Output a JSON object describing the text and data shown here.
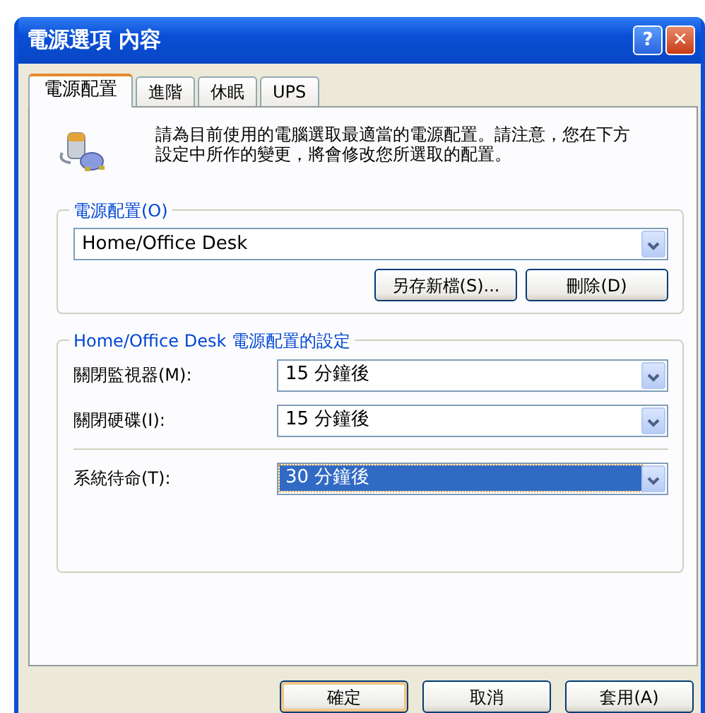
{
  "window": {
    "title": "電源選項 內容"
  },
  "title_buttons": [
    {
      "kind": "help",
      "label": "?"
    },
    {
      "kind": "close",
      "label": "✕"
    }
  ],
  "tabs": [
    {
      "label": "電源配置",
      "selected": true
    },
    {
      "label": "進階",
      "selected": false
    },
    {
      "label": "休眠",
      "selected": false
    },
    {
      "label": "UPS",
      "selected": false
    }
  ],
  "description": "請為目前使用的電腦選取最適當的電源配置。請注意，您在下方設定中所作的變更，將會修改您所選取的配置。",
  "scheme_group": {
    "legend": "電源配置(O)",
    "value": "Home/Office Desk",
    "buttons": [
      "另存新檔(S)...",
      "刪除(D)"
    ]
  },
  "settings_group": {
    "legend": "Home/Office Desk 電源配置的設定",
    "rows": [
      {
        "label": "關閉監視器(M):",
        "value": "15 分鐘後",
        "focused": false
      },
      {
        "label": "關閉硬碟(I):",
        "value": "15 分鐘後",
        "focused": false
      },
      {
        "label": "系統待命(T):",
        "value": "30 分鐘後",
        "focused": true
      }
    ]
  },
  "buttons": [
    {
      "label": "確定",
      "default": true
    },
    {
      "label": "取消",
      "default": false
    },
    {
      "label": "套用(A)",
      "default": false
    }
  ]
}
